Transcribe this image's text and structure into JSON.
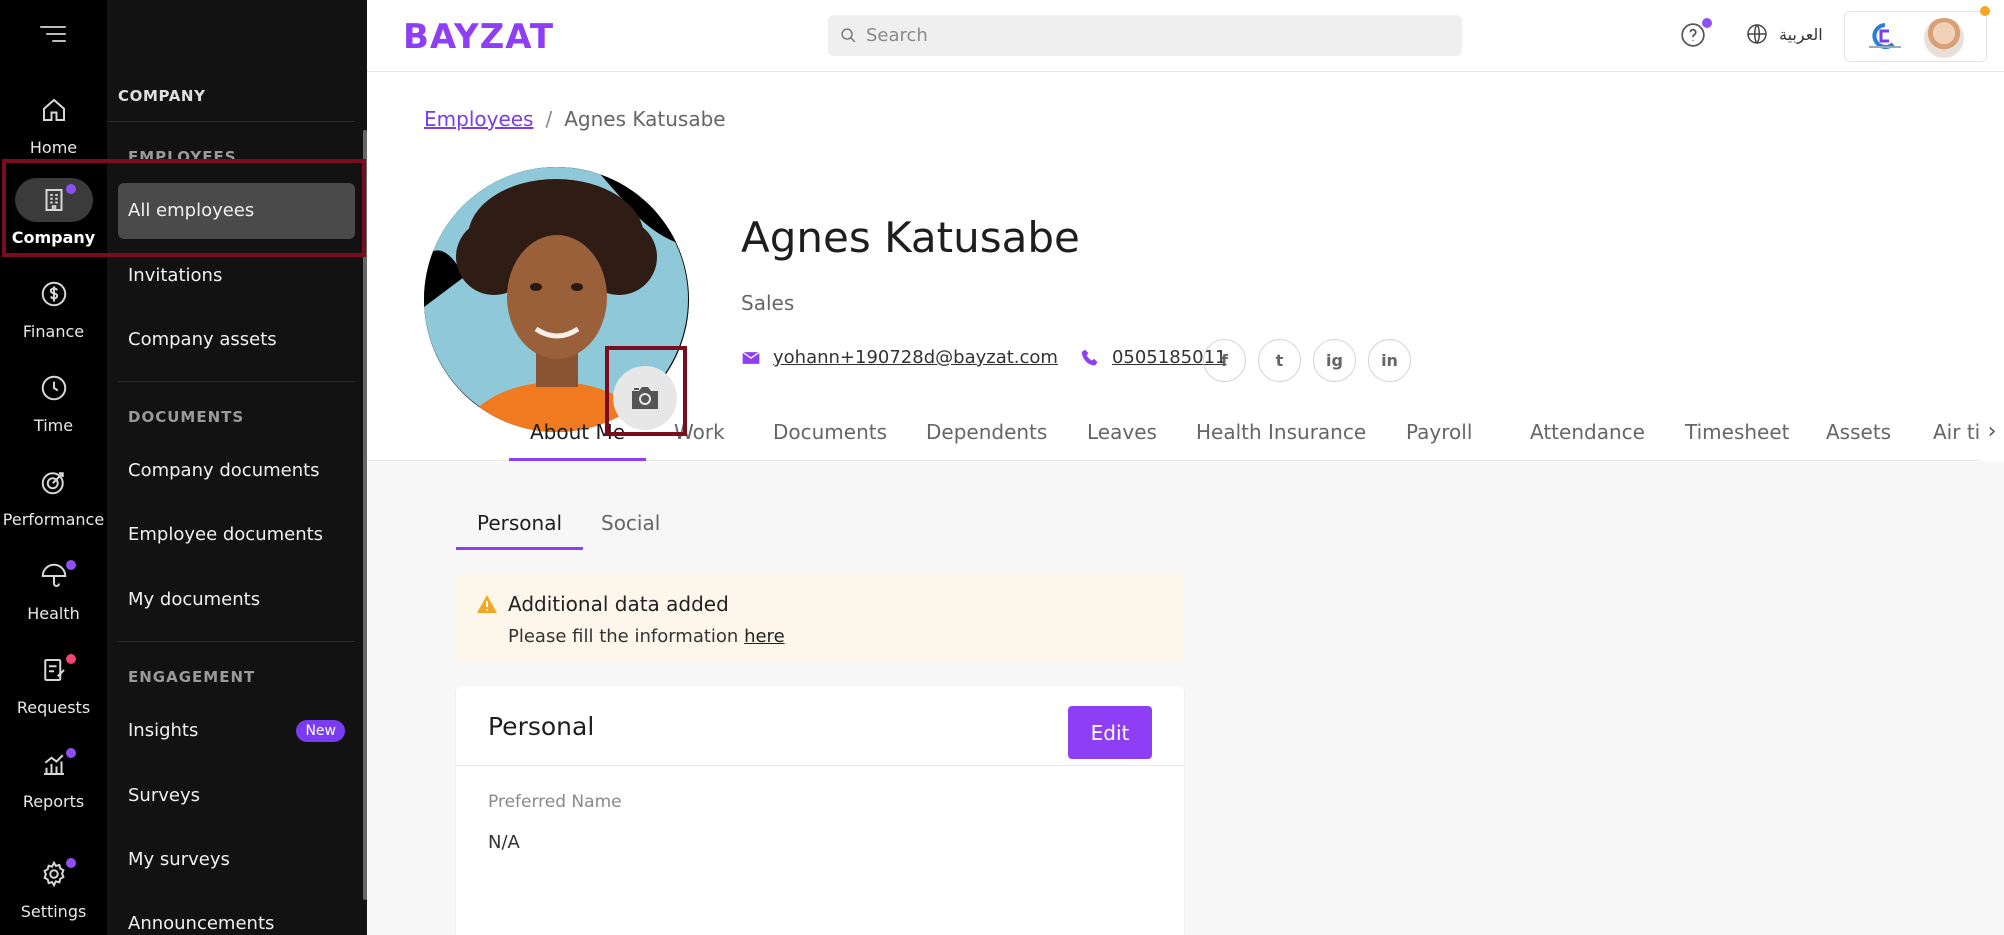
{
  "rail": {
    "items": [
      {
        "label": "Home"
      },
      {
        "label": "Company"
      },
      {
        "label": "Finance"
      },
      {
        "label": "Time"
      },
      {
        "label": "Performance"
      },
      {
        "label": "Health"
      },
      {
        "label": "Requests"
      },
      {
        "label": "Reports"
      },
      {
        "label": "Settings"
      }
    ]
  },
  "subnav": {
    "title": "COMPANY",
    "sections": {
      "employees": "EMPLOYEES",
      "documents": "DOCUMENTS",
      "engagement": "ENGAGEMENT"
    },
    "items": {
      "all_employees": "All employees",
      "invitations": "Invitations",
      "company_assets": "Company assets",
      "company_documents": "Company documents",
      "employee_documents": "Employee documents",
      "my_documents": "My documents",
      "insights": "Insights",
      "insights_badge": "New",
      "surveys": "Surveys",
      "my_surveys": "My surveys",
      "announcements": "Announcements"
    }
  },
  "topbar": {
    "logo": "BAYZAT",
    "search_placeholder": "Search",
    "language": "العربية"
  },
  "breadcrumb": {
    "parent": "Employees",
    "separator": "/",
    "current": "Agnes Katusabe"
  },
  "profile": {
    "name": "Agnes Katusabe",
    "department": "Sales",
    "email": "yohann+190728d@bayzat.com",
    "phone": "0505185011",
    "socials": [
      "f",
      "t",
      "ig",
      "in"
    ]
  },
  "tabs": [
    "About Me",
    "Work",
    "Documents",
    "Dependents",
    "Leaves",
    "Health Insurance",
    "Payroll",
    "Attendance",
    "Timesheet",
    "Assets",
    "Air tic"
  ],
  "subtabs": [
    "Personal",
    "Social"
  ],
  "alert": {
    "title": "Additional data added",
    "message": "Please fill the information ",
    "link": "here"
  },
  "card": {
    "title": "Personal",
    "edit_label": "Edit",
    "field_label": "Preferred Name",
    "field_value": "N/A"
  },
  "colors": {
    "brand": "#8e3ff5",
    "highlight": "#7a0c1e"
  }
}
